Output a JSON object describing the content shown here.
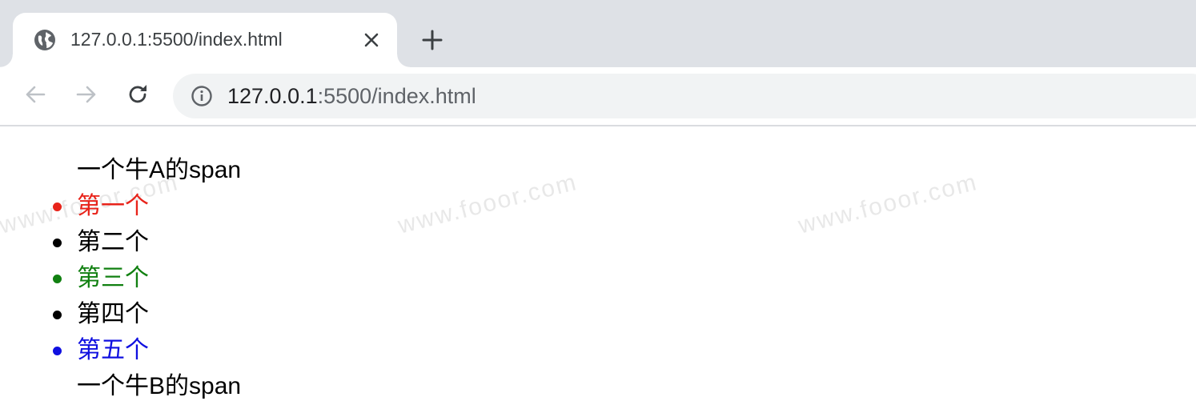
{
  "browser": {
    "tab": {
      "title": "127.0.0.1:5500/index.html"
    },
    "address_bar": {
      "host": "127.0.0.1",
      "path": ":5500/index.html"
    }
  },
  "page": {
    "span_a": "一个牛A的span",
    "list_items": [
      {
        "text": "第一个",
        "color": "#e8231a"
      },
      {
        "text": "第二个",
        "color": "#000000"
      },
      {
        "text": "第三个",
        "color": "#118011"
      },
      {
        "text": "第四个",
        "color": "#000000"
      },
      {
        "text": "第五个",
        "color": "#1010e0"
      }
    ],
    "span_b": "一个牛B的span"
  },
  "watermark": "www.fooor.com",
  "colors": {
    "tabstrip": "#dee1e6",
    "omnibox": "#f1f3f4"
  }
}
